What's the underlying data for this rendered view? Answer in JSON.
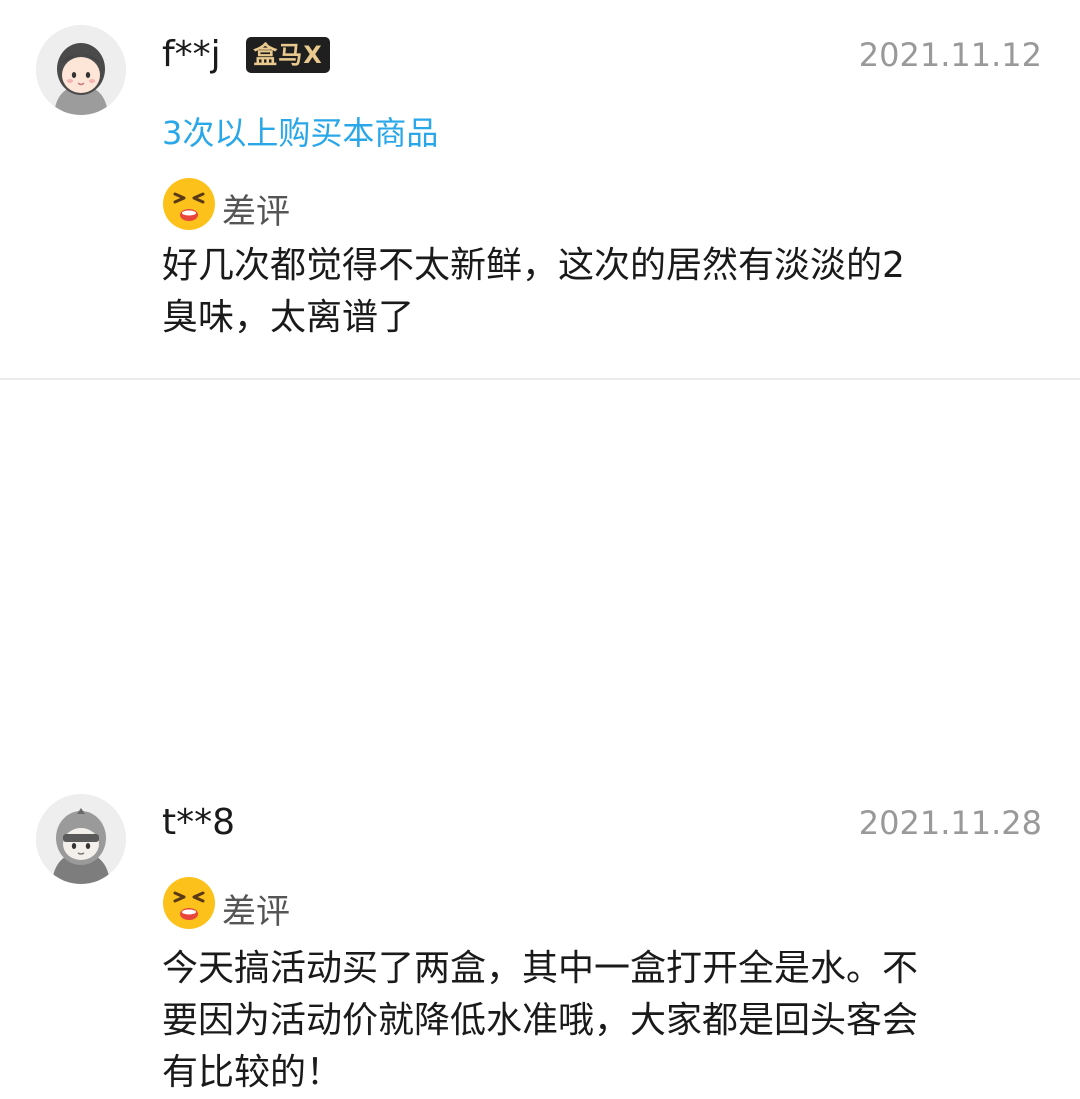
{
  "reviews": [
    {
      "username": "f**j",
      "badge": "盒马X",
      "date": "2021.11.12",
      "repeat_purchase": "3次以上购买本商品",
      "rating_label": "差评",
      "content": "好几次都觉得不太新鲜，这次的居然有淡淡的2\n臭味，太离谱了"
    },
    {
      "username": "t**8",
      "date": "2021.11.28",
      "rating_label": "差评",
      "content": "今天搞活动买了两盒，其中一盒打开全是水。不\n要因为活动价就降低水准哦，大家都是回头客会\n有比较的！"
    }
  ],
  "colors": {
    "accent_blue": "#2aa7e8",
    "date_gray": "#999999",
    "badge_bg": "#1f1f1f",
    "badge_text": "#e9c98e",
    "emoji_yellow": "#fcc21b"
  },
  "icons": {
    "avatar_1": "cartoon-girl-avatar",
    "avatar_2": "cartoon-hooded-avatar",
    "rating": "angry-face-emoji"
  }
}
